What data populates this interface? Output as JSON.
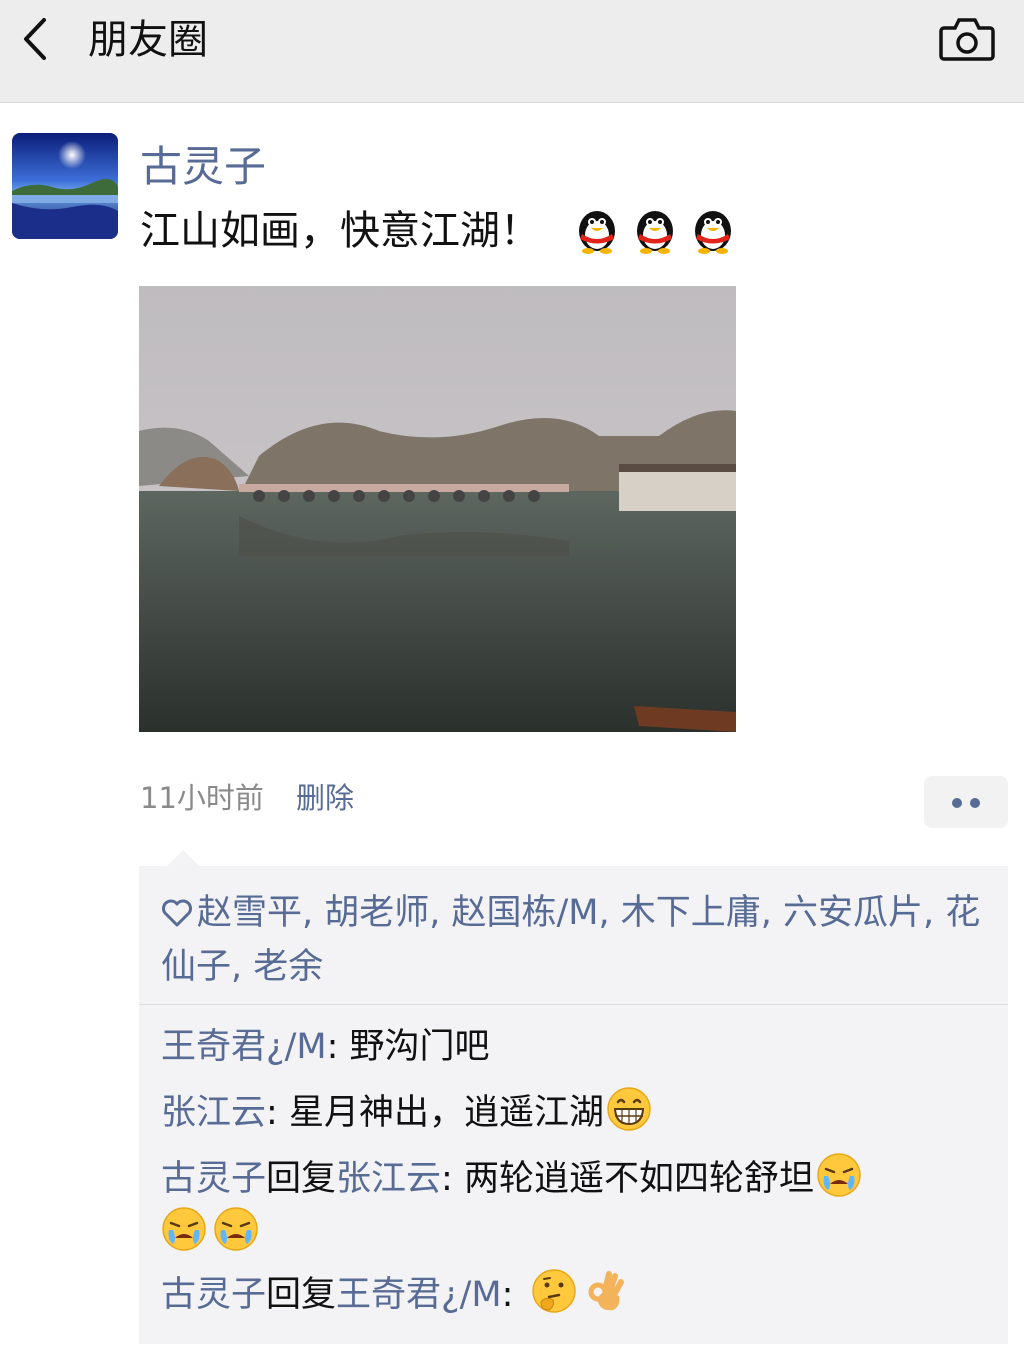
{
  "header": {
    "title": "朋友圈",
    "back_icon": "chevron-left-icon",
    "camera_icon": "camera-icon"
  },
  "post": {
    "author": "古灵子",
    "text": "江山如画，快意江湖！",
    "text_emojis": [
      "penguin-emoji",
      "penguin-emoji",
      "penguin-emoji"
    ],
    "time": "11小时前",
    "delete_label": "删除"
  },
  "likes": {
    "icon": "heart-outline-icon",
    "names": "赵雪平, 胡老师, 赵国栋/M, 木下上庸, 六安瓜片, 花仙子, 老余"
  },
  "comments": [
    {
      "name": "王奇君¿/M",
      "sep": ": ",
      "text": "野沟门吧"
    },
    {
      "name": "张江云",
      "sep": ": ",
      "text": "星月神出，逍遥江湖",
      "emojis": [
        "grin-emoji"
      ]
    },
    {
      "name": "古灵子",
      "reply_word": "回复",
      "reply_to": "张江云",
      "sep": ": ",
      "text": "两轮逍遥不如四轮舒坦",
      "emojis": [
        "crying-emoji",
        "crying-emoji",
        "crying-emoji"
      ]
    },
    {
      "name": "古灵子",
      "reply_word": "回复",
      "reply_to": "王奇君¿/M",
      "sep": ": ",
      "text": "",
      "emojis": [
        "thinking-emoji",
        "ok-hand-emoji"
      ]
    }
  ],
  "colors": {
    "link": "#576b95",
    "bar": "#ededed",
    "comment_bg": "#f3f3f5"
  }
}
